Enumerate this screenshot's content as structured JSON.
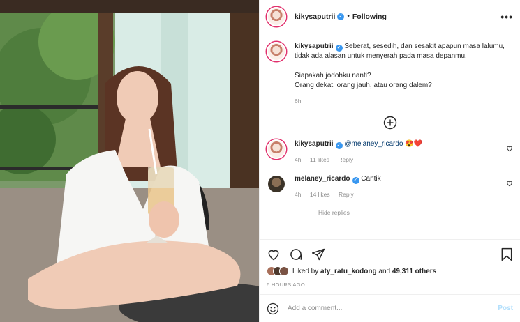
{
  "header": {
    "username": "kikysaputrii",
    "separator": "•",
    "follow_label": "Following",
    "more_label": "•••"
  },
  "caption": {
    "username": "kikysaputrii",
    "line1": "Seberat, sesedih, dan sesakit apapun masa lalumu,",
    "line2": "tidak ada alasan untuk menyerah pada masa depanmu.",
    "line3": "Siapakah jodohku nanti?",
    "line4": "Orang dekat, orang jauh, atau orang dalem?",
    "time": "6h"
  },
  "comments": [
    {
      "username": "kikysaputrii",
      "mention": "@melaney_ricardo",
      "text": "😍❤️",
      "time": "4h",
      "likes": "11 likes",
      "reply_label": "Reply"
    },
    {
      "username": "melaney_ricardo",
      "mention": "",
      "text": "Cantik",
      "time": "4h",
      "likes": "14 likes",
      "reply_label": "Reply"
    }
  ],
  "hide_replies_label": "Hide replies",
  "likes": {
    "prefix": "Liked by",
    "user": "aty_ratu_kodong",
    "joiner": "and",
    "count": "49,311 others"
  },
  "timestamp": "6 HOURS AGO",
  "add_comment": {
    "placeholder": "Add a comment...",
    "post_label": "Post"
  },
  "colors": {
    "verified": "#3897f0",
    "link": "#00376b",
    "post_disabled": "#b2dffc",
    "story_ring": "#e1306c"
  },
  "icons": [
    "heart-icon",
    "comment-icon",
    "share-icon",
    "bookmark-icon",
    "emoji-icon",
    "add-icon",
    "more-icon",
    "verified-icon"
  ]
}
